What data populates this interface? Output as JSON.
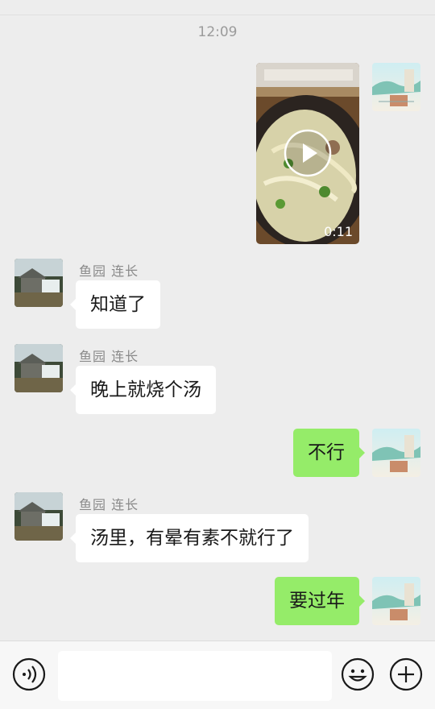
{
  "chat": {
    "timestamp": "12:09",
    "video": {
      "duration": "0:11"
    },
    "messages": [
      {
        "sender": "鱼园  连长",
        "text": "知道了"
      },
      {
        "sender": "鱼园  连长",
        "text": "晚上就烧个汤"
      },
      {
        "text": "不行"
      },
      {
        "sender": "鱼园  连长",
        "text": "汤里，有晕有素不就行了"
      },
      {
        "text": "要过年"
      }
    ]
  },
  "input_bar": {
    "voice_icon": "voice-icon",
    "emoji_icon": "emoji-icon",
    "more_icon": "plus-icon",
    "text_value": ""
  },
  "colors": {
    "background": "#ededed",
    "outgoing_bubble": "#95ec69",
    "incoming_bubble": "#ffffff",
    "sender_name": "#8a8a8a"
  }
}
